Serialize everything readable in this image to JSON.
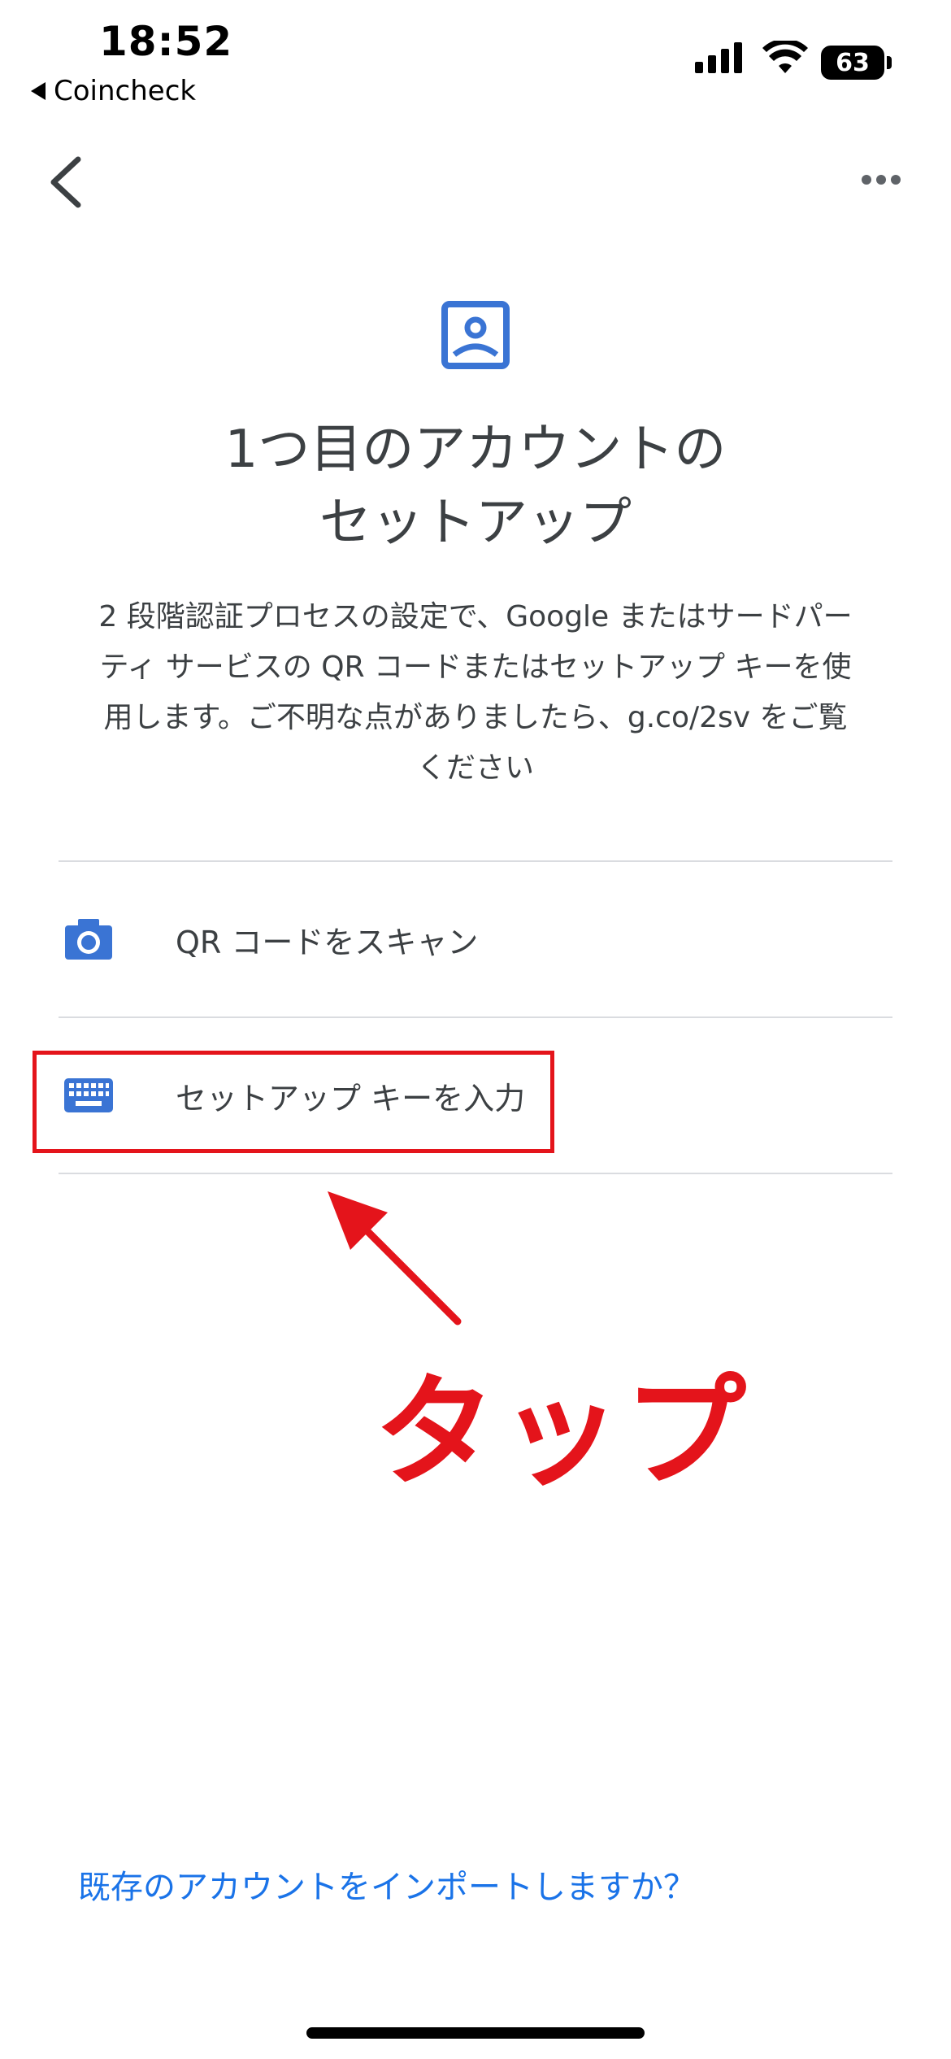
{
  "status_bar": {
    "time": "18:52",
    "back_app": "Coincheck",
    "battery": "63"
  },
  "app_bar": {
    "back_icon": "chevron-left-icon",
    "more_icon": "more-horizontal-icon"
  },
  "hero": {
    "icon": "account-box-icon",
    "title_line1": "1つ目のアカウントの",
    "title_line2": "セットアップ",
    "description_line1": "2 段階認証プロセスの設定で、Google またはサードパー",
    "description_line2": "ティ サービスの QR コードまたはセットアップ キーを使",
    "description_line3": "用します。ご不明な点がありましたら、g.co/2sv をご覧",
    "description_line4": "ください"
  },
  "options": [
    {
      "label": "QR コードをスキャン",
      "icon": "camera-icon"
    },
    {
      "label": "セットアップ キーを入力",
      "icon": "keyboard-icon"
    }
  ],
  "annotation": {
    "tap_text": "タップ",
    "color": "#e4141b"
  },
  "footer": {
    "import_link": "既存のアカウントをインポートしますか？"
  },
  "colors": {
    "accent": "#1a73e8",
    "icon_blue": "#3a74d4",
    "text": "#3c4043"
  }
}
